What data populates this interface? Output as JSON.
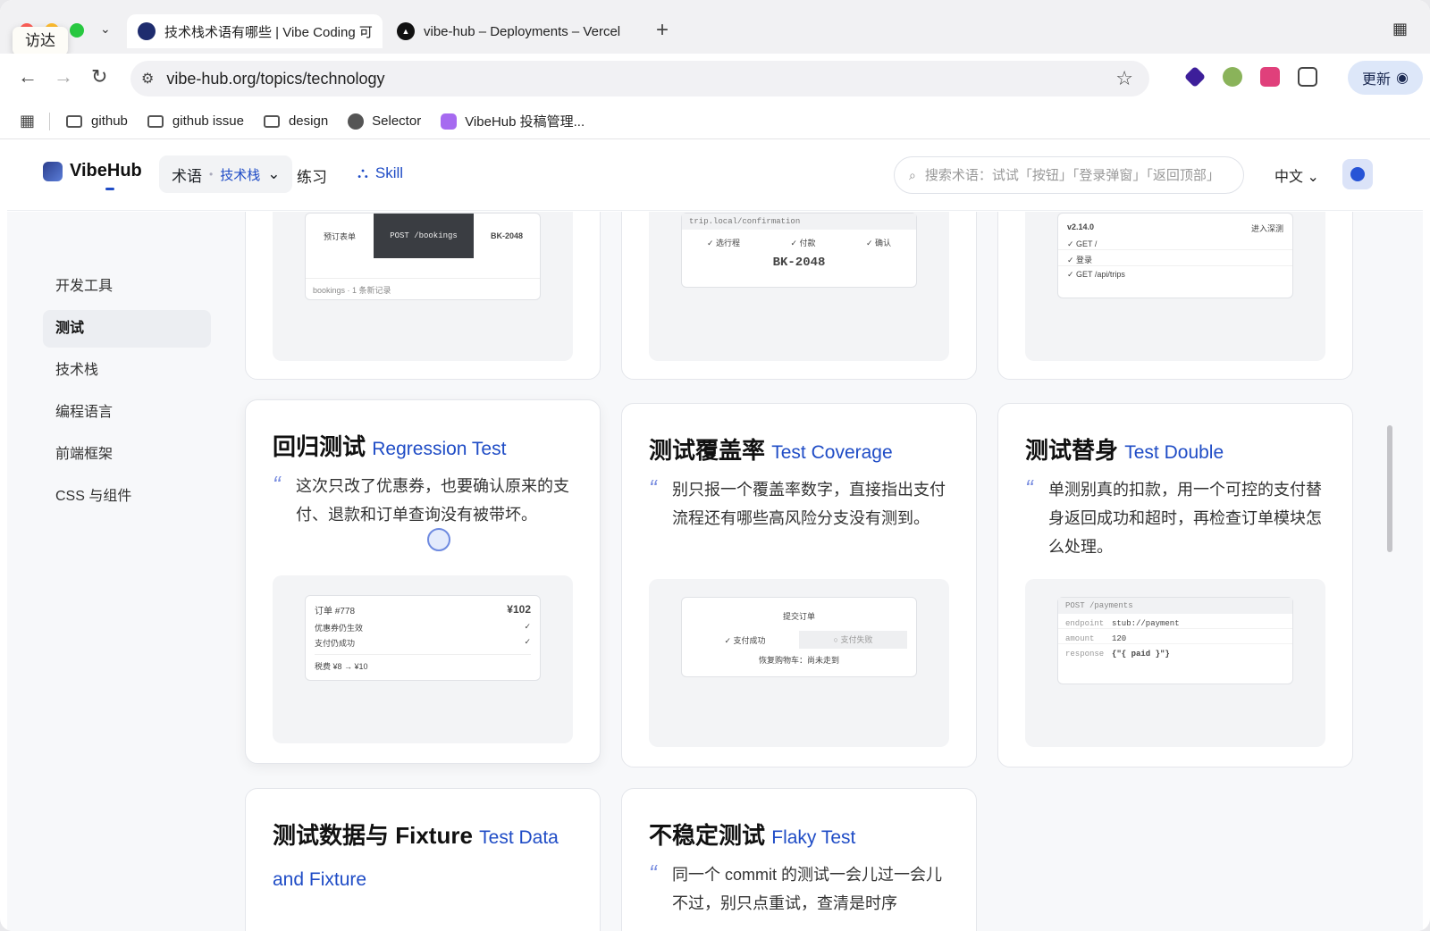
{
  "browser": {
    "finder_tooltip": "访达",
    "tabs": [
      {
        "title": "技术栈术语有哪些 | Vibe Coding 可",
        "active": true,
        "icon": "vibehub-favicon"
      },
      {
        "title": "vibe-hub – Deployments – Vercel",
        "active": false,
        "icon": "vercel-favicon"
      }
    ],
    "new_tab_label": "+",
    "url": "vibe-hub.org/topics/technology",
    "update_label": "更新",
    "bookmarks": [
      {
        "label": "github",
        "icon": "folder-icon"
      },
      {
        "label": "github issue",
        "icon": "folder-icon"
      },
      {
        "label": "design",
        "icon": "folder-icon"
      },
      {
        "label": "Selector",
        "icon": "globe-icon"
      },
      {
        "label": "VibeHub 投稿管理...",
        "icon": "vibehub-icon"
      }
    ]
  },
  "site": {
    "logo_text": "VibeHub",
    "nav_term": "术语",
    "nav_term_sub": "技术栈",
    "nav_practice": "练习",
    "nav_skill": "Skill",
    "search_placeholder": "搜索术语：试试「按钮」「登录弹窗」「返回顶部」",
    "lang": "中文"
  },
  "sidebar": {
    "items": [
      {
        "label": "开发工具",
        "active": false
      },
      {
        "label": "测试",
        "active": true
      },
      {
        "label": "技术栈",
        "active": false
      },
      {
        "label": "编程语言",
        "active": false
      },
      {
        "label": "前端框架",
        "active": false
      },
      {
        "label": "CSS 与组件",
        "active": false
      }
    ]
  },
  "top_cards": {
    "card1": {
      "left_label": "预订表单",
      "dark_label": "POST /bookings",
      "right_label": "BK-2048",
      "footer": "bookings · 1 条新记录"
    },
    "card2": {
      "url": "trip.local/confirmation",
      "steps": [
        "✓ 选行程",
        "✓ 付款",
        "✓ 确认"
      ],
      "code": "BK-2048"
    },
    "card3": {
      "version": "v2.14.0",
      "action": "进入深测",
      "checks": [
        "✓ GET /",
        "✓ 登录",
        "✓ GET /api/trips"
      ]
    }
  },
  "cards": [
    {
      "title_zh": "回归测试",
      "title_en": "Regression Test",
      "quote": "这次只改了优惠券，也要确认原来的支付、退款和订单查询没有被带坏。",
      "preview": {
        "order": "订单 #778",
        "amount": "¥102",
        "rows": [
          {
            "label": "优惠券仍生效",
            "mark": "✓"
          },
          {
            "label": "支付仍成功",
            "mark": "✓"
          }
        ],
        "footer": "税费 ¥8 → ¥10"
      }
    },
    {
      "title_zh": "测试覆盖率",
      "title_en": "Test Coverage",
      "quote": "别只报一个覆盖率数字，直接指出支付流程还有哪些高风险分支没有测到。",
      "preview": {
        "heading": "提交订单",
        "ok": "✓ 支付成功",
        "fail": "○ 支付失败",
        "footer": "恢复购物车：尚未走到"
      }
    },
    {
      "title_zh": "测试替身",
      "title_en": "Test Double",
      "quote": "单测别真的扣款，用一个可控的支付替身返回成功和超时，再检查订单模块怎么处理。",
      "preview": {
        "header": "POST /payments",
        "rows": [
          {
            "k": "endpoint",
            "v": "stub://payment"
          },
          {
            "k": "amount",
            "v": "120"
          },
          {
            "k": "response",
            "v": "{\"{ paid }\"}"
          }
        ]
      }
    },
    {
      "title_zh": "测试数据与 Fixture",
      "title_en": "Test Data and Fixture",
      "quote": ""
    },
    {
      "title_zh": "不稳定测试",
      "title_en": "Flaky Test",
      "quote": "同一个 commit 的测试一会儿过一会儿不过，别只点重试，查清是时序"
    }
  ],
  "colors": {
    "accent": "#1f4cc6",
    "sidebar_active_bg": "#eceef2",
    "page_bg": "#f7f8fa"
  }
}
